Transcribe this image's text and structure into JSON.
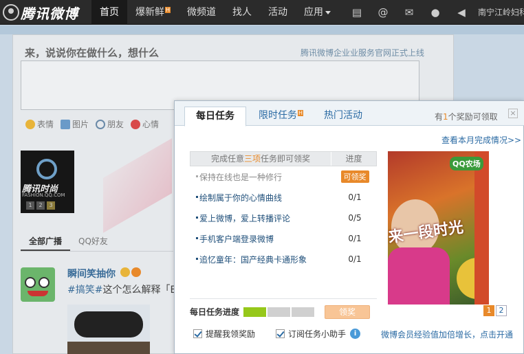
{
  "brand": {
    "name": "腾讯微博"
  },
  "nav": {
    "items": [
      {
        "label": "首页",
        "active": true
      },
      {
        "label": "爆新鲜",
        "hot": "H"
      },
      {
        "label": "微频道"
      },
      {
        "label": "找人"
      },
      {
        "label": "活动"
      },
      {
        "label": "应用",
        "dropdown": true
      }
    ],
    "tools": [
      "compose-icon",
      "at-icon",
      "mail-icon",
      "user-icon",
      "volume-icon"
    ],
    "user_location": "南宁江岭妇科"
  },
  "composer": {
    "title": "来，说说你在做什么，想什么",
    "announcement": "腾讯微博企业业服务官网正式上线",
    "toolbar": [
      "表情",
      "图片",
      "朋友",
      "心情"
    ]
  },
  "side_ad": {
    "title": "腾讯时尚",
    "subtitle": "FASHION.QQ.COM",
    "pages": [
      "1",
      "2",
      "3"
    ]
  },
  "feed": {
    "tabs": [
      "全部广播",
      "QQ好友"
    ],
    "post": {
      "author": "瞬间笑抽你",
      "tag": "#搞笑#",
      "text": "这个怎么解释「B"
    }
  },
  "popup": {
    "tabs": [
      {
        "label": "每日任务",
        "active": true
      },
      {
        "label": "限时任务",
        "hot": "H"
      },
      {
        "label": "热门活动"
      }
    ],
    "reward_prefix": "有",
    "reward_count": "1",
    "reward_suffix": "个奖励可领取",
    "close": "×",
    "month_link": "查看本月完成情况>>",
    "table_head": {
      "pre": "完成任意",
      "highlight": "三项",
      "post": "任务即可领奖",
      "progress": "进度"
    },
    "tasks": [
      {
        "name": "保持在线也是一种修行",
        "progress": "可领奖",
        "done": true
      },
      {
        "name": "绘制属于你的心情曲线",
        "progress": "0/1"
      },
      {
        "name": "爱上微博，爱上转播评论",
        "progress": "0/5"
      },
      {
        "name": "手机客户端登录微博",
        "progress": "0/1"
      },
      {
        "name": "追忆童年：国产经典卡通形象",
        "progress": "0/1"
      }
    ],
    "daily_progress_label": "每日任务进度",
    "daily_progress_filled": 1,
    "daily_progress_total": 3,
    "claim_button": "领奖",
    "banner": {
      "logo": "QQ农场",
      "slogan": "来一段时光"
    },
    "banner_pages": [
      "1",
      "2"
    ],
    "option_remind": "提醒我领奖励",
    "option_subscribe": "订阅任务小助手",
    "member_link": "微博会员经验值加倍增长，点击开通"
  },
  "colors": {
    "accent": "#e8892a",
    "link": "#2a6aa3",
    "progress_fill": "#96c81a",
    "topbar": "#2b2b2b"
  }
}
